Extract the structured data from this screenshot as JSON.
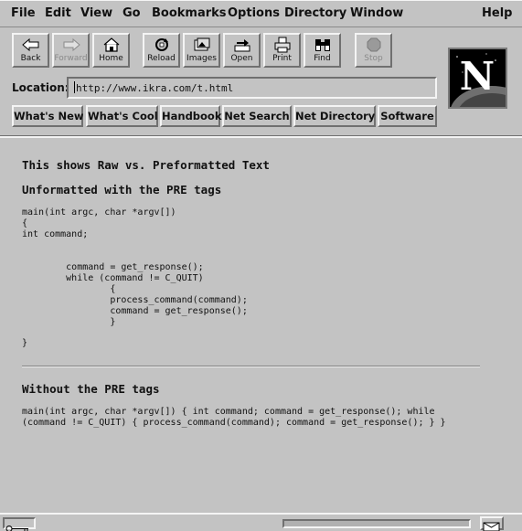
{
  "menu": [
    "File",
    "Edit",
    "View",
    "Go",
    "Bookmarks",
    "Options",
    "Directory",
    "Window",
    "Help"
  ],
  "toolbar": [
    {
      "label": "Back",
      "icon": "back-arrow-icon",
      "enabled": true
    },
    {
      "label": "Forward",
      "icon": "forward-arrow-icon",
      "enabled": false
    },
    {
      "label": "Home",
      "icon": "home-icon",
      "enabled": true
    },
    {
      "label": "Reload",
      "icon": "reload-icon",
      "enabled": true
    },
    {
      "label": "Images",
      "icon": "images-icon",
      "enabled": true
    },
    {
      "label": "Open",
      "icon": "open-icon",
      "enabled": true
    },
    {
      "label": "Print",
      "icon": "print-icon",
      "enabled": true
    },
    {
      "label": "Find",
      "icon": "find-binoculars-icon",
      "enabled": true
    },
    {
      "label": "Stop",
      "icon": "stop-icon",
      "enabled": false
    }
  ],
  "location": {
    "label": "Location:",
    "url": "http://www.ikra.com/t.html"
  },
  "directory_buttons": [
    "What's New",
    "What's Cool",
    "Handbook",
    "Net Search",
    "Net Directory",
    "Software"
  ],
  "logo": {
    "letter": "N"
  },
  "content": {
    "heading1": "This shows Raw vs. Preformatted Text",
    "heading2": "Unformatted with the PRE tags",
    "pre_lines": [
      "main(int argc, char *argv[])",
      "{",
      "int command;",
      "",
      "",
      "        command = get_response();",
      "        while (command != C_QUIT)",
      "                {",
      "                process_command(command);",
      "                command = get_response();",
      "                }",
      "",
      "}"
    ],
    "heading3": "Without the PRE tags",
    "plain_lines": [
      "main(int argc, char *argv[]) { int command; command = get_response(); while",
      "(command != C_QUIT) { process_command(command); command = get_response(); } }"
    ]
  },
  "colors": {
    "chrome": "#c3c3c3",
    "text": "#111111"
  }
}
